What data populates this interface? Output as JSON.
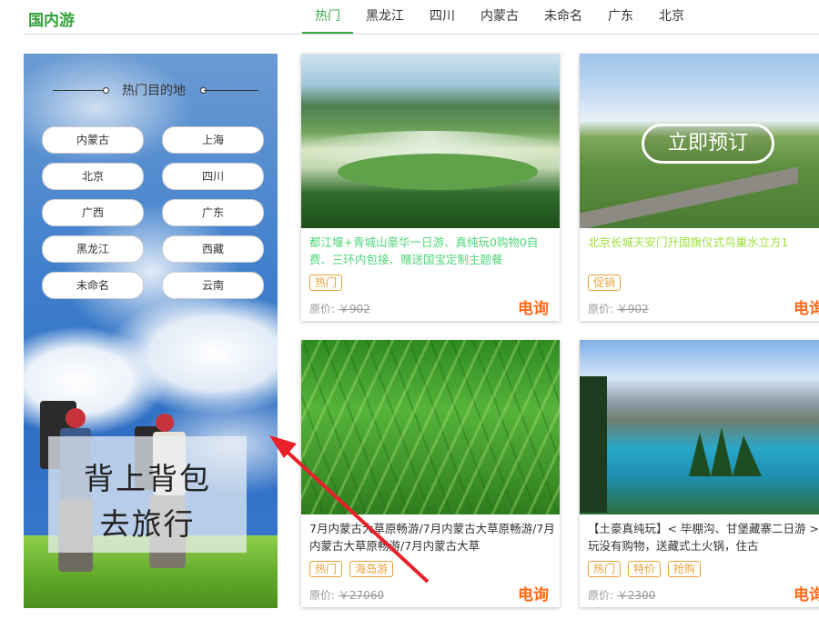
{
  "header": {
    "brand": "国内游",
    "tabs": [
      "热门",
      "黑龙江",
      "四川",
      "内蒙古",
      "未命名",
      "广东",
      "北京"
    ],
    "active_tab": "热门",
    "accent": "#3aa845"
  },
  "sidebar": {
    "title": "热门目的地",
    "destinations": [
      "内蒙古",
      "上海",
      "北京",
      "四川",
      "广西",
      "广东",
      "黑龙江",
      "西藏",
      "未命名",
      "云南"
    ],
    "promo_line1": "背上背包",
    "promo_line2": "去旅行"
  },
  "cards": [
    {
      "title": "都江堰+青城山豪华一日游、真纯玩0购物0自费、三环内包接、赠送国宝定制主题餐",
      "title_color": "#4fd67a",
      "tags": [
        "热门"
      ],
      "orig_label": "原价:",
      "orig_price": "￥902",
      "price_text": "电询"
    },
    {
      "title": "北京长城天安门升国旗仪式鸟巢水立方1",
      "title_color": "#9be03a",
      "tags": [
        "促销"
      ],
      "orig_label": "原价:",
      "orig_price": "￥902",
      "price_text": "电询",
      "overlay_button": "立即预订"
    },
    {
      "title": "7月内蒙古大草原畅游/7月内蒙古大草原畅游/7月内蒙古大草原畅游/7月内蒙古大草",
      "title_color": "#333333",
      "tags": [
        "热门",
        "海岛游"
      ],
      "orig_label": "原价:",
      "orig_price": "￥27060",
      "price_text": "电询"
    },
    {
      "title": "【土豪真纯玩】< 毕棚沟、甘堡藏寨二日游 > 纯玩没有购物，送藏式土火锅，住古",
      "title_color": "#333333",
      "tags": [
        "热门",
        "特价",
        "抢购"
      ],
      "orig_label": "原价:",
      "orig_price": "￥2300",
      "price_text": "电询"
    }
  ]
}
